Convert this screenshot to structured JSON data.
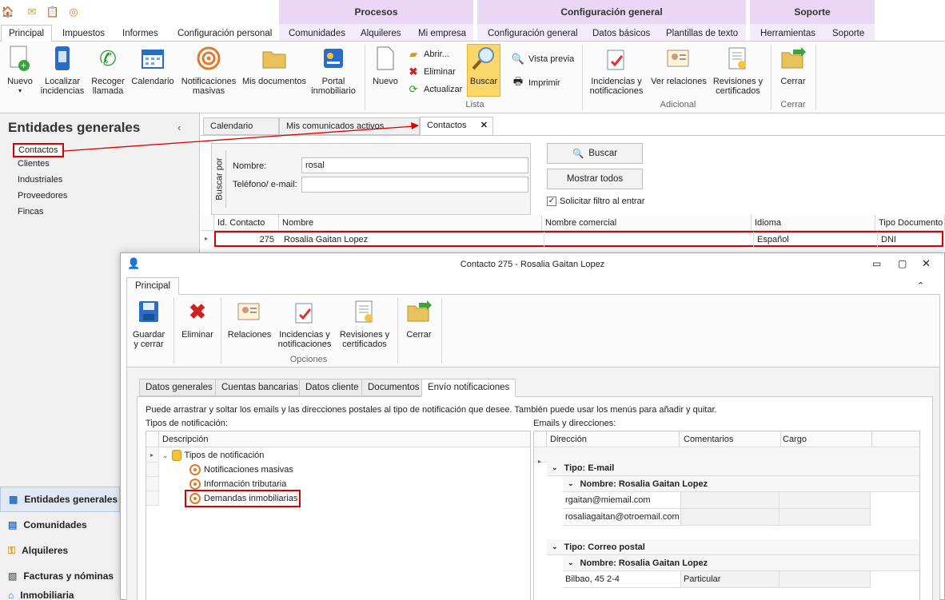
{
  "ribbon": {
    "context_groups": [
      "Procesos",
      "Configuración general",
      "Soporte"
    ],
    "tabs": [
      "Principal",
      "Impuestos",
      "Informes",
      "Configuración personal",
      "Comunidades",
      "Alquileres",
      "Mi empresa",
      "Configuración general",
      "Datos básicos",
      "Plantillas de texto",
      "Herramientas",
      "Soporte"
    ],
    "buttons": {
      "nuevo": "Nuevo",
      "localizar_1": "Localizar",
      "localizar_2": "incidencias",
      "recoger_1": "Recoger",
      "recoger_2": "llamada",
      "calendario": "Calendario",
      "notif_1": "Notificaciones",
      "notif_2": "masivas",
      "mis_docs": "Mis documentos",
      "portal_1": "Portal",
      "portal_2": "inmobiliario",
      "nuevo2": "Nuevo",
      "abrir": "Abrir...",
      "eliminar": "Eliminar",
      "actualizar": "Actualizar",
      "buscar": "Buscar",
      "vista_previa": "Vista previa",
      "imprimir": "Imprimir",
      "incid_1": "Incidencias y",
      "incid_2": "notificaciones",
      "ver_relaciones": "Ver relaciones",
      "revis_1": "Revisiones y",
      "revis_2": "certificados",
      "cerrar": "Cerrar"
    },
    "groups": {
      "lista": "Lista",
      "adicional": "Adicional",
      "cerrar": "Cerrar"
    }
  },
  "left_panel": {
    "title": "Entidades generales",
    "items": [
      "Contactos",
      "Clientes",
      "Industriales",
      "Proveedores",
      "Fincas"
    ],
    "nav": [
      "Entidades generales",
      "Comunidades",
      "Alquileres",
      "Facturas y nóminas",
      "Inmobiliaria"
    ]
  },
  "doc_tabs": [
    "Calendario",
    "Mis comunicados activos",
    "Contactos"
  ],
  "search": {
    "vertical_label": "Buscar por",
    "nombre_label": "Nombre:",
    "nombre_value": "rosal",
    "telefono_label": "Teléfono/ e-mail:",
    "telefono_value": "",
    "buscar_button": "Buscar",
    "mostrar_todos": "Mostrar todos",
    "solicitar_filtro": "Solicitar filtro al entrar"
  },
  "grid": {
    "columns": [
      "Id. Contacto",
      "Nombre",
      "Nombre comercial",
      "Idioma",
      "Tipo Documento"
    ],
    "row": {
      "id": "275",
      "nombre": "Rosalia Gaitan Lopez",
      "comercial": "",
      "idioma": "Español",
      "tipo_doc": "DNI"
    }
  },
  "popup": {
    "title": "Contacto 275 - Rosalia Gaitan Lopez",
    "ribbon_tab": "Principal",
    "buttons": {
      "guardar_1": "Guardar",
      "guardar_2": "y cerrar",
      "eliminar": "Eliminar",
      "relaciones": "Relaciones",
      "incid_1": "Incidencias y",
      "incid_2": "notificaciones",
      "revis_1": "Revisiones y",
      "revis_2": "certificados",
      "cerrar": "Cerrar"
    },
    "group_opciones": "Opciones",
    "tabs": [
      "Datos generales",
      "Cuentas bancarias",
      "Datos cliente",
      "Documentos",
      "Envío notificaciones"
    ],
    "instructions": "Puede arrastrar y soltar los emails y las direcciones postales al tipo de notificación que desee. También puede usar los menús para añadir y quitar.",
    "tipos_label": "Tipos de notificación:",
    "emails_label": "Emails y direcciones:",
    "tree_header": "Descripción",
    "tree": {
      "root": "Tipos de notificación",
      "children": [
        "Notificaciones masivas",
        "Información tributaria",
        "Demandas inmobiliarias"
      ]
    },
    "email_grid": {
      "columns": [
        "Dirección",
        "Comentarios",
        "Cargo"
      ],
      "group_email": "Tipo: E-mail",
      "group_postal": "Tipo: Correo postal",
      "subgroup": "Nombre: Rosalia Gaitan Lopez",
      "emails": [
        "rgaitan@miemail.com",
        "rosaliagaitan@otroemail.com"
      ],
      "postal": [
        {
          "direccion": "Bilbao, 45 2-4",
          "comentarios": "Particular"
        }
      ]
    }
  },
  "colors": {
    "accent_red": "#d60000",
    "context_purple": "#ead6f5",
    "buscar_highlight": "#fbd76a"
  }
}
